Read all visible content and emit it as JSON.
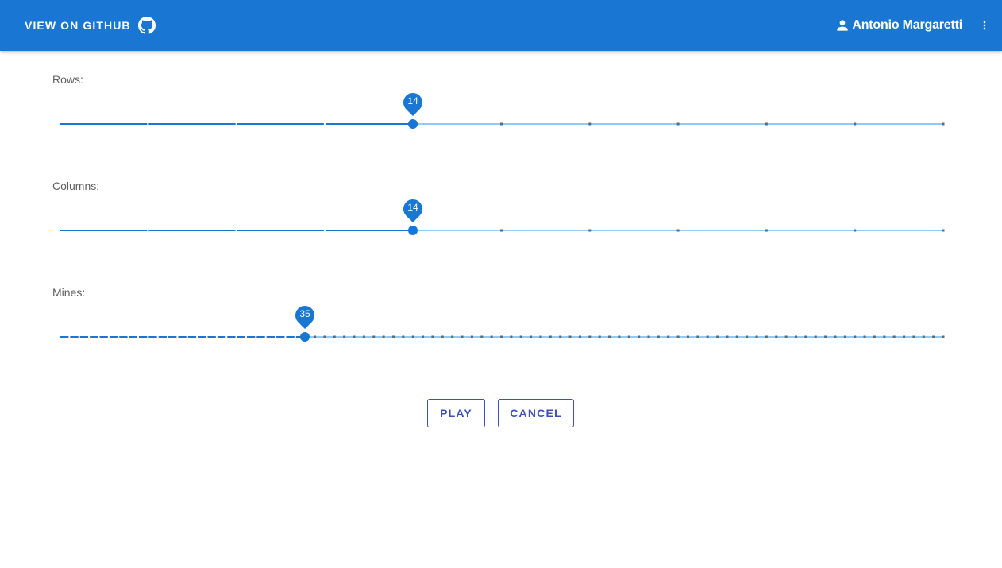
{
  "header": {
    "github_label": "View on GitHub",
    "github_icon": "github-icon",
    "user_icon": "person-icon",
    "user_name": "Antonio Margaretti",
    "menu_icon": "more-vert-icon"
  },
  "sliders": [
    {
      "label": "Rows:",
      "value": 14,
      "value_text": "14",
      "min": 10,
      "max": 20,
      "step": 1
    },
    {
      "label": "Columns:",
      "value": 14,
      "value_text": "14",
      "min": 10,
      "max": 20,
      "step": 1
    },
    {
      "label": "Mines:",
      "value": 35,
      "value_text": "35",
      "min": 10,
      "max": 100,
      "step": 1
    }
  ],
  "actions": {
    "play_label": "PLAY",
    "cancel_label": "CANCEL"
  },
  "colors": {
    "primary": "#1976d2",
    "track_inactive": "#90caf9",
    "tick": "#546e7a",
    "button": "#3f51b5"
  }
}
